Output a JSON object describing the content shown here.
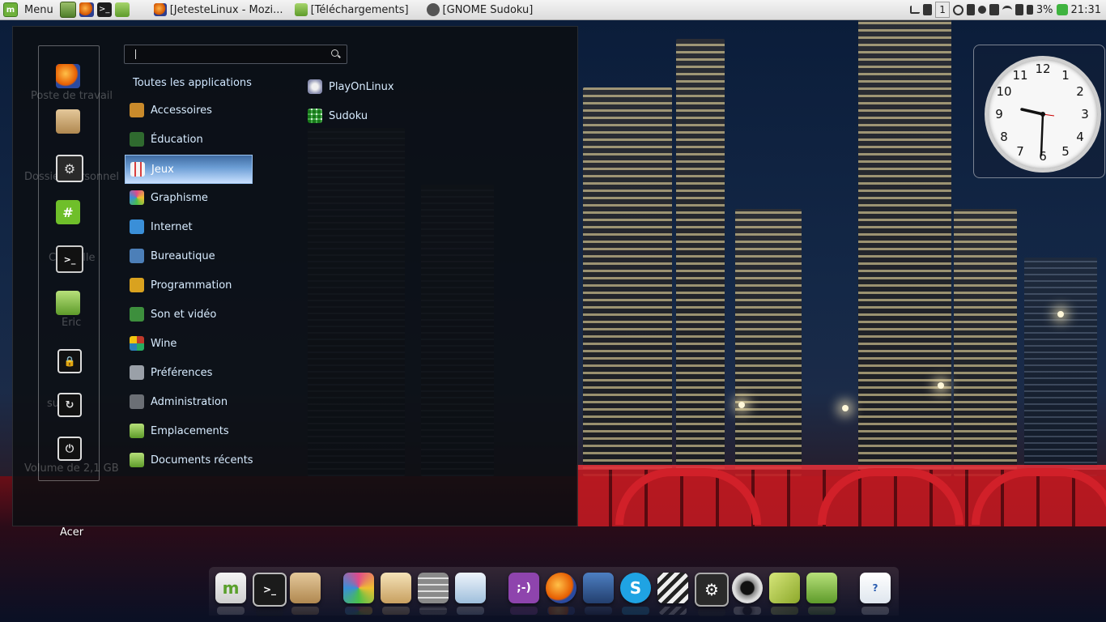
{
  "top_panel": {
    "menu_label": "Menu",
    "tasks": [
      {
        "label": "[JetesteLinux - Mozi...",
        "icon": "firefox-icon"
      },
      {
        "label": "[Téléchargements]",
        "icon": "folder-icon"
      },
      {
        "label": "[GNOME Sudoku]",
        "icon": "sudoku-icon"
      }
    ],
    "workspace": "1",
    "battery": "3%",
    "time": "21:31"
  },
  "menu": {
    "search_placeholder": "",
    "all_apps": "Toutes les applications",
    "categories": [
      {
        "label": "Accessoires",
        "color": "#c98a2b"
      },
      {
        "label": "Éducation",
        "color": "#2f6a2f"
      },
      {
        "label": "Jeux",
        "color": "#f0f0f0"
      },
      {
        "label": "Graphisme",
        "color": "#e04a8a"
      },
      {
        "label": "Internet",
        "color": "#3a8fd8"
      },
      {
        "label": "Bureautique",
        "color": "#4c7fb8"
      },
      {
        "label": "Programmation",
        "color": "#d9a21f"
      },
      {
        "label": "Son et vidéo",
        "color": "#3d8f3d"
      },
      {
        "label": "Wine",
        "color": "#c0392b"
      },
      {
        "label": "Préférences",
        "color": "#9aa0a8"
      },
      {
        "label": "Administration",
        "color": "#6b6f75"
      },
      {
        "label": "Emplacements",
        "color": "#7fbf4a"
      },
      {
        "label": "Documents récents",
        "color": "#7fbf4a"
      }
    ],
    "active_category": "Jeux",
    "apps": [
      {
        "label": "PlayOnLinux",
        "icon": "playonlinux-icon"
      },
      {
        "label": "Sudoku",
        "icon": "sudoku-icon"
      }
    ],
    "ghost_labels": [
      "Poste de travail",
      "Dossier personnel",
      "Corbeille",
      "Eric",
      "sur-lux",
      "Volume de 2,1 GB"
    ]
  },
  "desktop": {
    "acer_label": "Acer"
  },
  "clock": {
    "numbers": [
      "12",
      "1",
      "2",
      "3",
      "4",
      "5",
      "6",
      "7",
      "8",
      "9",
      "10",
      "11"
    ]
  },
  "colors": {
    "accent": "#6fb13b",
    "menu_text": "#d8ecff",
    "selection": "#6d9fd6"
  }
}
